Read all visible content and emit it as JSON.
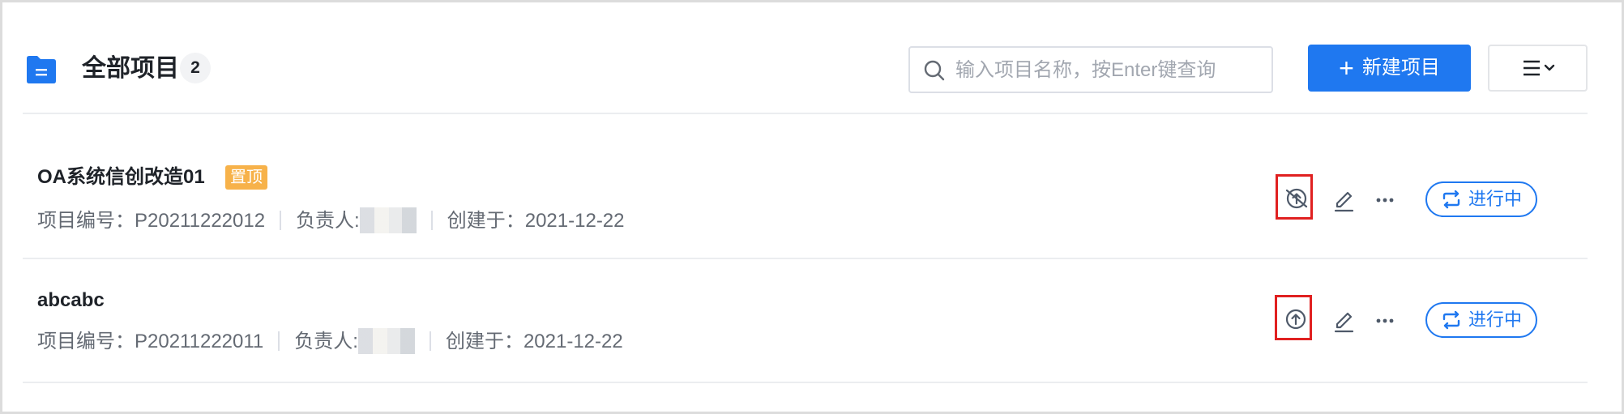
{
  "header": {
    "title": "全部项目",
    "count": "2",
    "folder_icon": "folder-icon",
    "search": {
      "placeholder": "输入项目名称，按Enter键查询",
      "value": ""
    },
    "new_button_label": "新建项目",
    "menu_icon": "list-menu-icon"
  },
  "projects": [
    {
      "name": "OA系统信创改造01",
      "pinned_tag": "置顶",
      "code_label": "项目编号：",
      "code": "P20211222012",
      "owner_label": "负责人:",
      "created_label": "创建于：",
      "created": "2021-12-22",
      "status": "进行中",
      "pin_action_icon": "unpin-icon"
    },
    {
      "name": "abcabc",
      "pinned_tag": "",
      "code_label": "项目编号：",
      "code": "P20211222011",
      "owner_label": "负责人:",
      "created_label": "创建于：",
      "created": "2021-12-22",
      "status": "进行中",
      "pin_action_icon": "pin-top-icon"
    }
  ],
  "colors": {
    "primary": "#1f78f0",
    "pin_tag": "#f7b24a",
    "highlight": "#e02020"
  }
}
